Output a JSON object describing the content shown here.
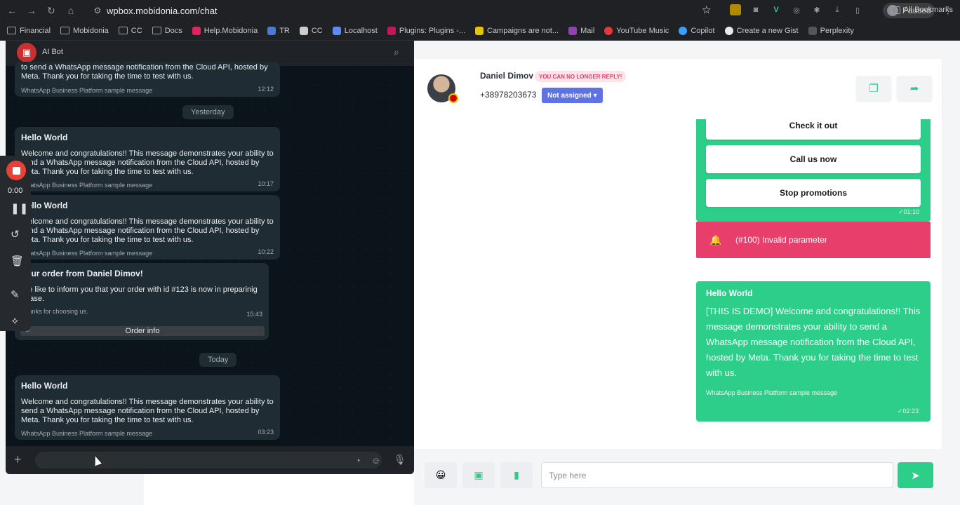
{
  "browser": {
    "url": "wpbox.mobidonia.com/chat",
    "profile_status": "Paused",
    "bookmarks": [
      "Financial",
      "Mobidonia",
      "CC",
      "Docs",
      "Help.Mobidonia",
      "TR",
      "CC",
      "Localhost",
      "Plugins: Plugins -...",
      "Campaigns are not...",
      "Mail",
      "YouTube Music",
      "Copilot",
      "Create a new Gist",
      "Perplexity"
    ],
    "all_bookmarks": "All Bookmarks"
  },
  "contact": {
    "name": "Daniel Dimov",
    "badge": "YOU CAN NO LONGER REPLY!",
    "phone": "+38978203673",
    "assign_label": "Not assigned"
  },
  "chat": {
    "quick_buttons": [
      "Check it out",
      "Call us now",
      "Stop promotions"
    ],
    "buttons_time": "01:10",
    "error_text": "(#100) Invalid parameter",
    "message": {
      "title": "Hello World",
      "body": "[THIS IS DEMO] Welcome and congratulations!! This message demonstrates your ability to send a WhatsApp message notification from the Cloud API, hosted by Meta. Thank you for taking the time to test with us.",
      "footer": "WhatsApp Business Platform sample message",
      "time": "02:23"
    }
  },
  "composer": {
    "placeholder": "Type here"
  },
  "whatsapp": {
    "title": "AI Bot",
    "top_snippet": "to send a WhatsApp message notification from the Cloud API, hosted by Meta. Thank you for taking the time to test with us.",
    "top_footer": "WhatsApp Business Platform sample message",
    "top_time": "12:12",
    "date_yesterday": "Yesterday",
    "date_today": "Today",
    "messages": [
      {
        "title": "Hello World",
        "text": "Welcome and congratulations!! This message demonstrates your ability to send a WhatsApp message notification from the Cloud API, hosted by Meta. Thank you for taking the time to test with us.",
        "footer": "WhatsApp Business Platform sample message",
        "time": "10:17"
      },
      {
        "title": "Hello World",
        "text": "Welcome and congratulations!! This message demonstrates your ability to send a WhatsApp message notification from the Cloud API, hosted by Meta. Thank you for taking the time to test with us.",
        "footer": "WhatsApp Business Platform sample message",
        "time": "10:22"
      },
      {
        "title": "Your order from Daniel Dimov!",
        "text": "We like to inform you that your order with id #123 is now in preparinig phase.",
        "footer": "Thanks for choosing us.",
        "time": "15:43",
        "button": "Order info"
      },
      {
        "title": "Hello World",
        "text": "Welcome and congratulations!! This message demonstrates your ability to send a WhatsApp message notification from the Cloud API, hosted by Meta. Thank you for taking the time to test with us.",
        "footer": "WhatsApp Business Platform sample message",
        "time": "03:23"
      }
    ]
  },
  "recorder": {
    "time": "0:00"
  },
  "colors": {
    "green": "#2dce89",
    "error": "#e83e6c",
    "assign": "#5e72e4",
    "wa_bg": "#0b141a"
  }
}
